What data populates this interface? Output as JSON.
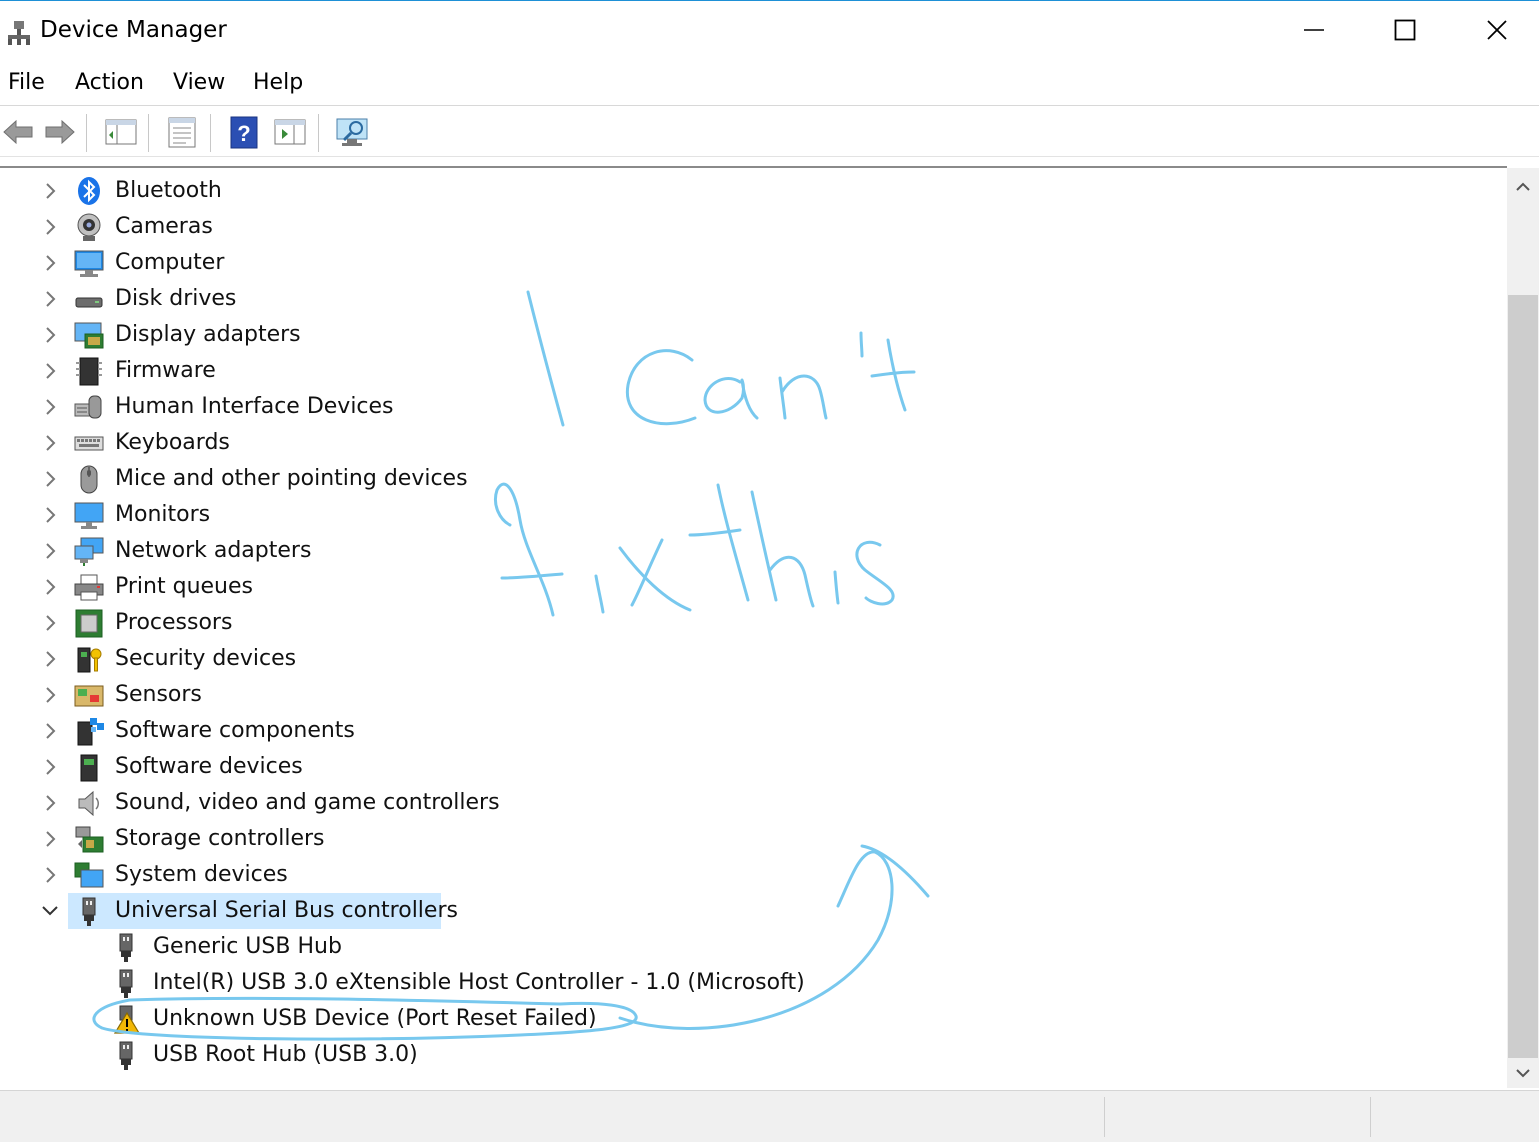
{
  "window": {
    "title": "Device Manager"
  },
  "menu": [
    "File",
    "Action",
    "View",
    "Help"
  ],
  "toolbar": {
    "buttons": [
      "back-arrow-icon",
      "forward-arrow-icon",
      "show-hide-console-tree-icon",
      "properties-icon",
      "help-icon",
      "update-driver-icon",
      "scan-hardware-changes-icon"
    ]
  },
  "tree": {
    "categories": [
      {
        "label": "Bluetooth",
        "icon": "bluetooth-icon"
      },
      {
        "label": "Cameras",
        "icon": "camera-icon"
      },
      {
        "label": "Computer",
        "icon": "computer-icon"
      },
      {
        "label": "Disk drives",
        "icon": "disk-drive-icon"
      },
      {
        "label": "Display adapters",
        "icon": "display-adapter-icon"
      },
      {
        "label": "Firmware",
        "icon": "firmware-icon"
      },
      {
        "label": "Human Interface Devices",
        "icon": "hid-icon"
      },
      {
        "label": "Keyboards",
        "icon": "keyboard-icon"
      },
      {
        "label": "Mice and other pointing devices",
        "icon": "mouse-icon"
      },
      {
        "label": "Monitors",
        "icon": "monitor-icon"
      },
      {
        "label": "Network adapters",
        "icon": "network-adapter-icon"
      },
      {
        "label": "Print queues",
        "icon": "printer-icon"
      },
      {
        "label": "Processors",
        "icon": "processor-icon"
      },
      {
        "label": "Security devices",
        "icon": "security-device-icon"
      },
      {
        "label": "Sensors",
        "icon": "sensor-icon"
      },
      {
        "label": "Software components",
        "icon": "software-component-icon"
      },
      {
        "label": "Software devices",
        "icon": "software-device-icon"
      },
      {
        "label": "Sound, video and game controllers",
        "icon": "speaker-icon"
      },
      {
        "label": "Storage controllers",
        "icon": "storage-controller-icon"
      },
      {
        "label": "System devices",
        "icon": "system-device-icon"
      },
      {
        "label": "Universal Serial Bus controllers",
        "icon": "usb-icon",
        "expanded": true,
        "selected": true
      }
    ],
    "usb_children": [
      {
        "label": "Generic USB Hub",
        "icon": "usb-plug-icon"
      },
      {
        "label": "Intel(R) USB 3.0 eXtensible Host Controller - 1.0 (Microsoft)",
        "icon": "usb-plug-icon"
      },
      {
        "label": "Unknown USB Device (Port Reset Failed)",
        "icon": "warning-usb-icon",
        "warning": true
      },
      {
        "label": "USB Root Hub (USB 3.0)",
        "icon": "usb-plug-icon"
      }
    ]
  },
  "annotation": {
    "text": "I can't fix this",
    "color": "#78c8ee"
  },
  "colors": {
    "selection": "#cce8ff",
    "accent": "#1e90d6",
    "warning": "#f2b705"
  }
}
